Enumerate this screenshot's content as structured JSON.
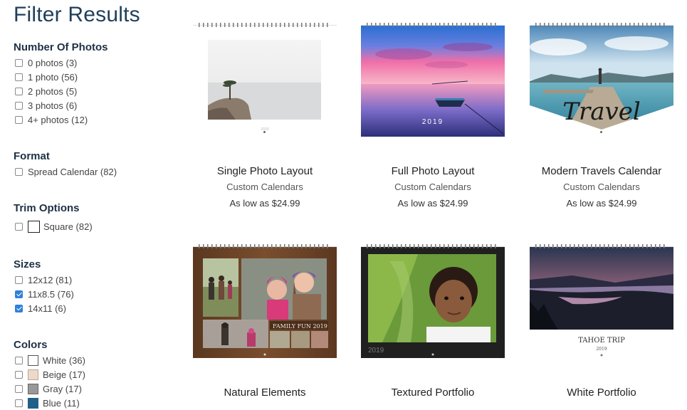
{
  "sidebar": {
    "title": "Filter Results",
    "groups": [
      {
        "heading": "Number Of Photos",
        "options": [
          {
            "label": "0 photos (3)",
            "checked": false
          },
          {
            "label": "1 photo (56)",
            "checked": false
          },
          {
            "label": "2 photos (5)",
            "checked": false
          },
          {
            "label": "3 photos (6)",
            "checked": false
          },
          {
            "label": "4+ photos (12)",
            "checked": false
          }
        ]
      },
      {
        "heading": "Format",
        "options": [
          {
            "label": "Spread Calendar (82)",
            "checked": false
          }
        ]
      },
      {
        "heading": "Trim Options",
        "options": [
          {
            "label": "Square (82)",
            "checked": false
          }
        ]
      },
      {
        "heading": "Sizes",
        "options": [
          {
            "label": "12x12 (81)",
            "checked": false
          },
          {
            "label": "11x8.5 (76)",
            "checked": true
          },
          {
            "label": "14x11 (6)",
            "checked": true
          }
        ]
      },
      {
        "heading": "Colors",
        "options": [
          {
            "label": "White (36)",
            "checked": false,
            "color": "#ffffff"
          },
          {
            "label": "Beige (17)",
            "checked": false,
            "color": "#ecd9c8"
          },
          {
            "label": "Gray (17)",
            "checked": false,
            "color": "#999999"
          },
          {
            "label": "Blue (11)",
            "checked": false,
            "color": "#1f5f8a"
          }
        ]
      }
    ]
  },
  "products": [
    {
      "name": "Single Photo Layout",
      "category": "Custom Calendars",
      "price": "As low as $24.99"
    },
    {
      "name": "Full Photo Layout",
      "category": "Custom Calendars",
      "price": "As low as $24.99",
      "year": "2019"
    },
    {
      "name": "Modern Travels Calendar",
      "category": "Custom Calendars",
      "price": "As low as $24.99",
      "script": "Travel"
    },
    {
      "name": "Natural Elements",
      "banner": "FAMILY FUN",
      "year": "2019"
    },
    {
      "name": "Textured Portfolio",
      "year": "2019"
    },
    {
      "name": "White Portfolio",
      "caption": "TAHOE TRIP",
      "year": "2019"
    }
  ]
}
